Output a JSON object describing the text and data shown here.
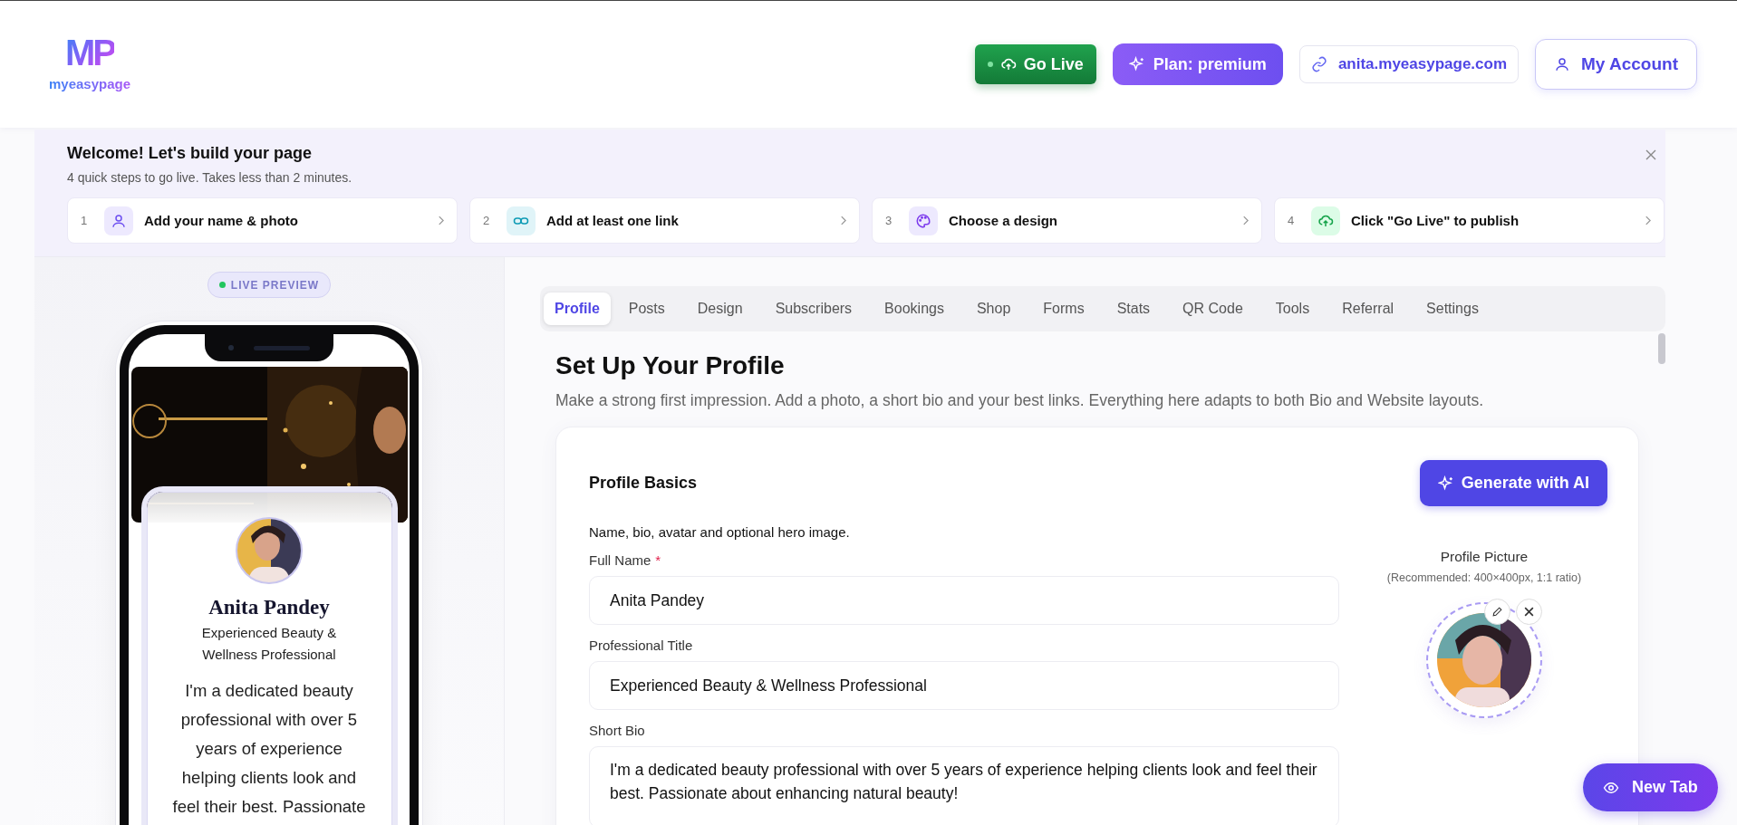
{
  "header": {
    "logo_mark": "MP",
    "logo_text": "myeasypage",
    "go_live": "Go Live",
    "plan": "Plan: premium",
    "url": "anita.myeasypage.com",
    "account": "My Account"
  },
  "welcome": {
    "title": "Welcome! Let's build your page",
    "subtitle": "4 quick steps to go live. Takes less than 2 minutes.",
    "steps": [
      {
        "number": "1",
        "label": "Add your name & photo",
        "kind": "person"
      },
      {
        "number": "2",
        "label": "Add at least one link",
        "kind": "link"
      },
      {
        "number": "3",
        "label": "Choose a design",
        "kind": "palette"
      },
      {
        "number": "4",
        "label": "Click \"Go Live\" to publish",
        "kind": "upload"
      }
    ]
  },
  "preview": {
    "badge": "LIVE PREVIEW",
    "name": "Anita Pandey",
    "title": "Experienced Beauty & Wellness Professional",
    "bio": "I'm a dedicated beauty professional with over 5 years of experience helping clients look and feel their best. Passionate"
  },
  "tabs": [
    {
      "label": "Profile",
      "selected": true
    },
    {
      "label": "Posts",
      "selected": false
    },
    {
      "label": "Design",
      "selected": false
    },
    {
      "label": "Subscribers",
      "selected": false
    },
    {
      "label": "Bookings",
      "selected": false
    },
    {
      "label": "Shop",
      "selected": false
    },
    {
      "label": "Forms",
      "selected": false
    },
    {
      "label": "Stats",
      "selected": false
    },
    {
      "label": "QR Code",
      "selected": false
    },
    {
      "label": "Tools",
      "selected": false
    },
    {
      "label": "Referral",
      "selected": false
    },
    {
      "label": "Settings",
      "selected": false
    }
  ],
  "profile": {
    "heading": "Set Up Your Profile",
    "subtitle": "Make a strong first impression. Add a photo, a short bio and your best links. Everything here adapts to both Bio and Website layouts.",
    "card_title": "Profile Basics",
    "generate": "Generate with AI",
    "description": "Name, bio, avatar and optional hero image.",
    "fields": [
      {
        "label": "Full Name",
        "required_mark": "*",
        "value": "Anita Pandey",
        "kind": "input"
      },
      {
        "label": "Professional Title",
        "value": "Experienced Beauty & Wellness Professional",
        "kind": "input"
      },
      {
        "label": "Short Bio",
        "value": "I'm a dedicated beauty professional with over 5 years of experience helping clients look and feel their best. Passionate about enhancing natural beauty!",
        "kind": "textarea"
      }
    ],
    "picture_title": "Profile Picture",
    "picture_hint": "(Recommended: 400×400px, 1:1 ratio)"
  },
  "new_tab": "New Tab"
}
